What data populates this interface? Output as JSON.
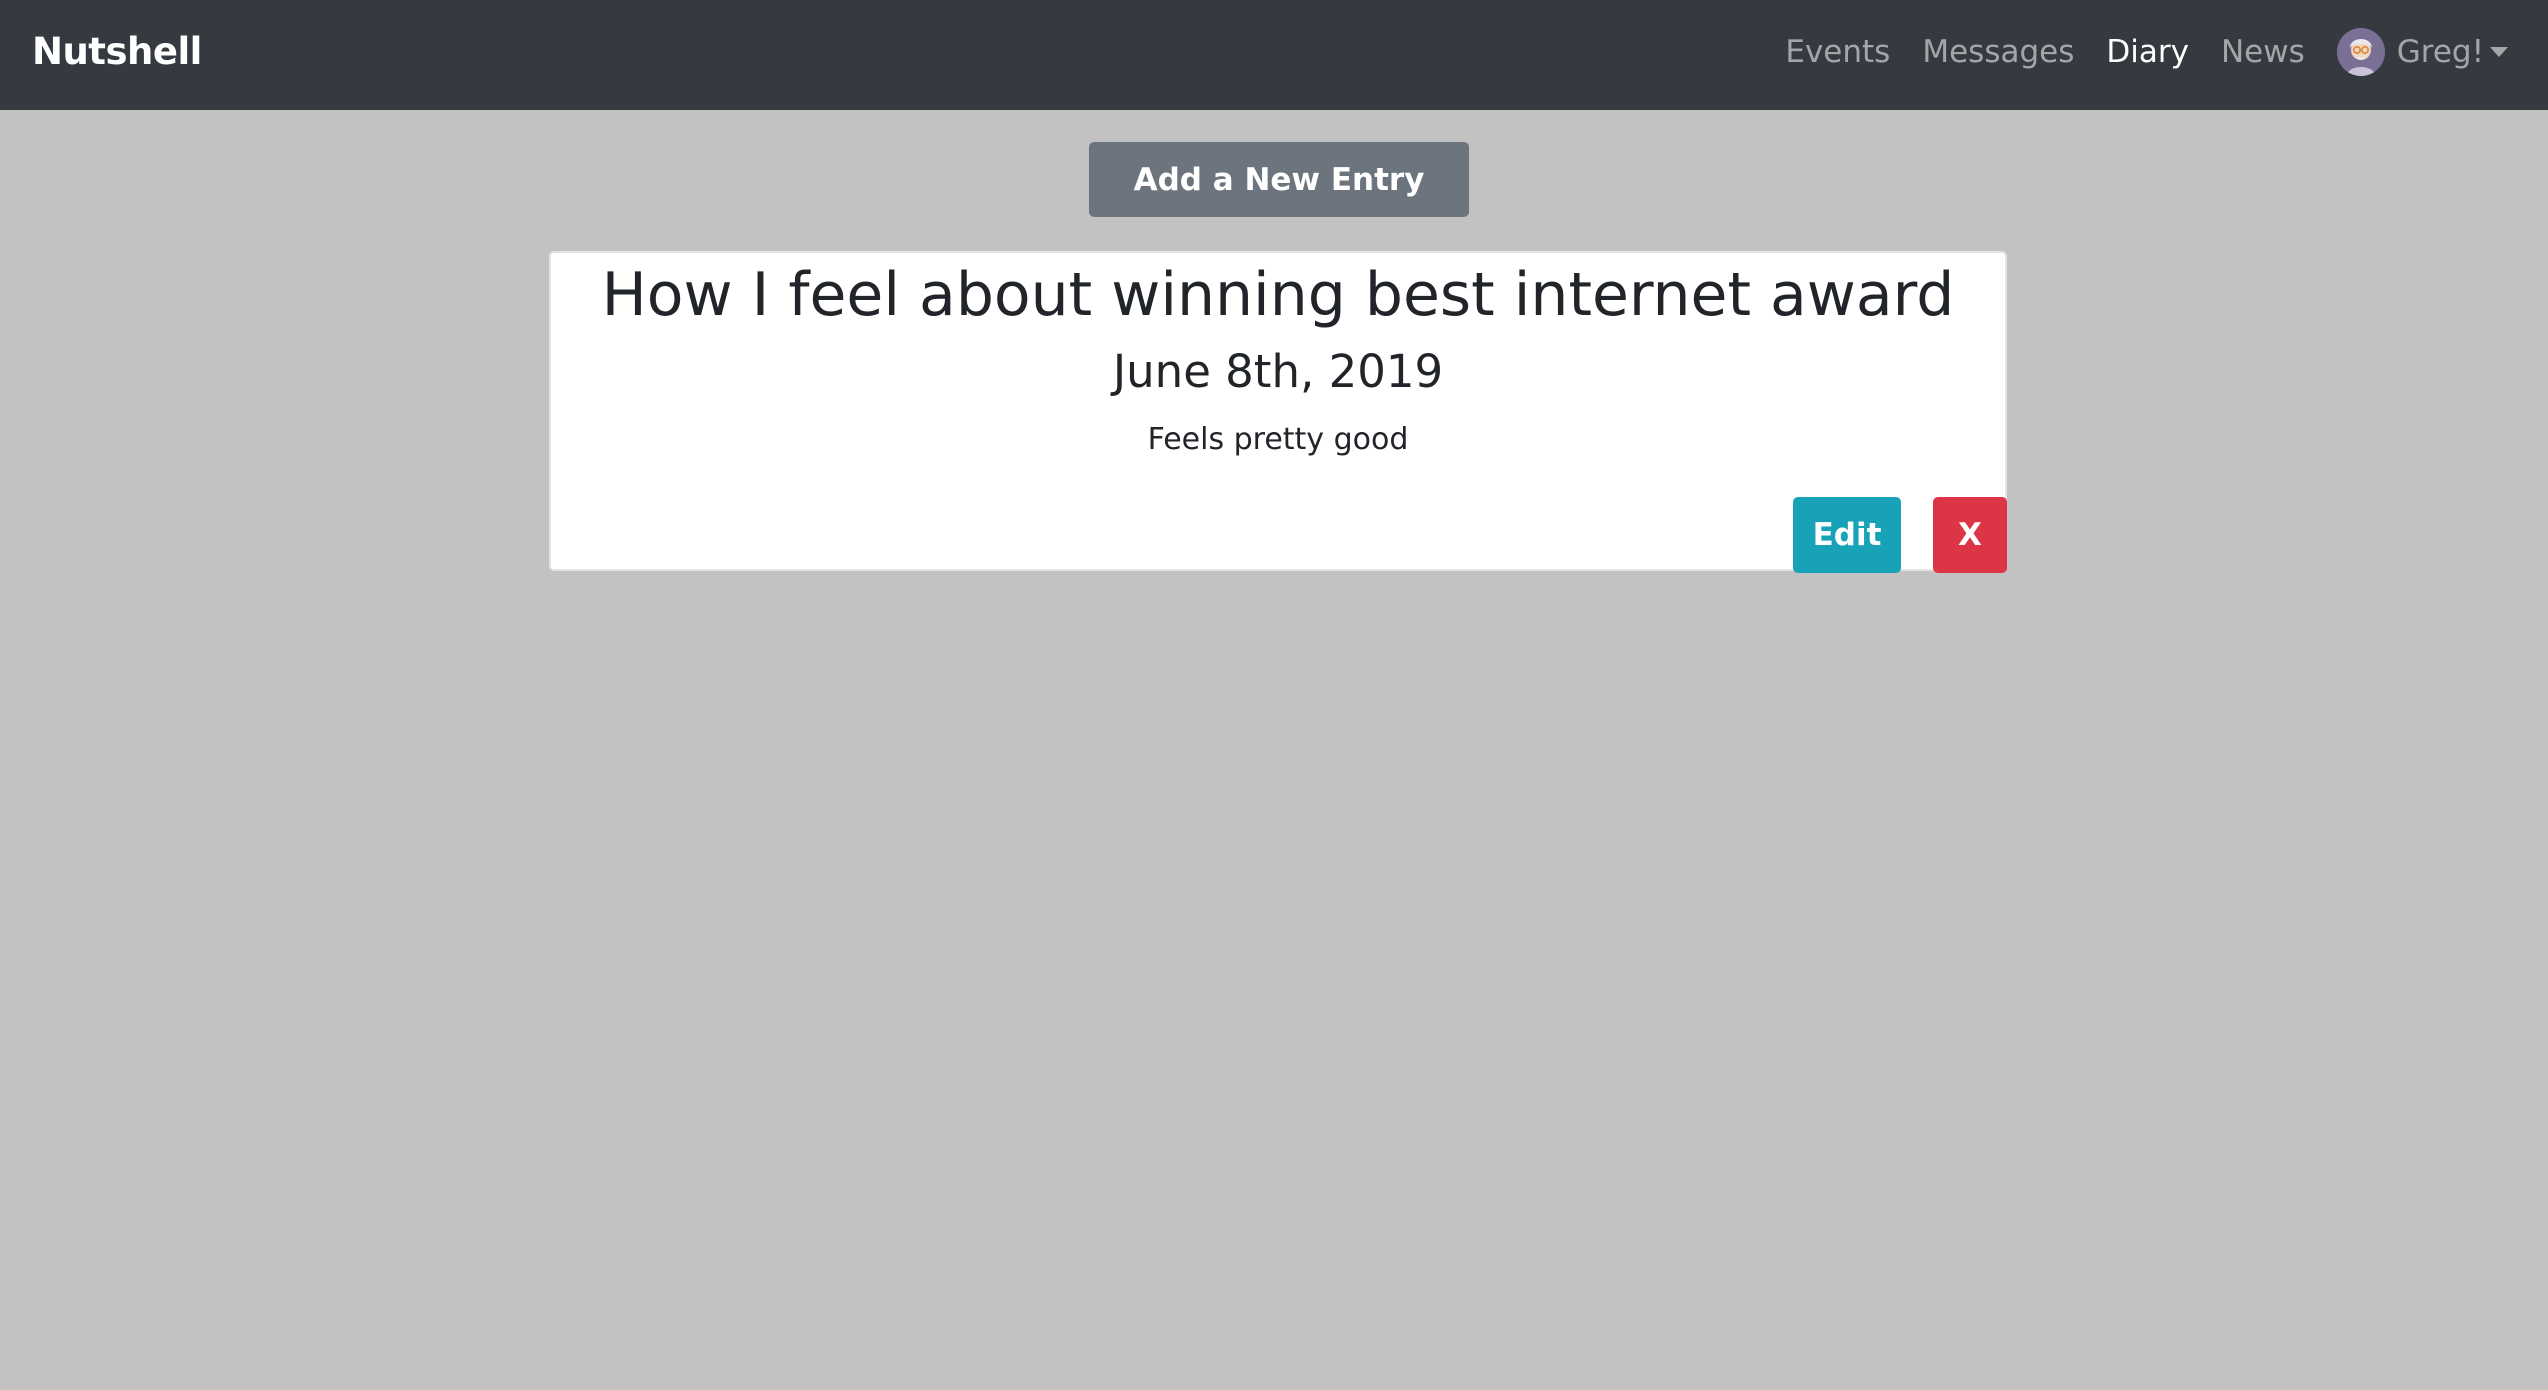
{
  "navbar": {
    "brand": "Nutshell",
    "links": [
      {
        "label": "Events",
        "active": false
      },
      {
        "label": "Messages",
        "active": false
      },
      {
        "label": "Diary",
        "active": true
      },
      {
        "label": "News",
        "active": false
      }
    ],
    "user": {
      "name": "Greg!",
      "avatar_icon": "user-avatar-icon",
      "dropdown_icon": "caret-down-icon"
    }
  },
  "main": {
    "add_button_label": "Add a New Entry"
  },
  "entries": [
    {
      "title": "How I feel about winning best internet award",
      "date": "June 8th, 2019",
      "body": "Feels pretty good",
      "edit_label": "Edit",
      "delete_label": "X"
    }
  ],
  "colors": {
    "navbar_bg": "#343a40",
    "page_bg": "#c2c2c2",
    "add_button": "#6c757d",
    "edit_button": "#17a2b8",
    "delete_button": "#dc3545"
  }
}
